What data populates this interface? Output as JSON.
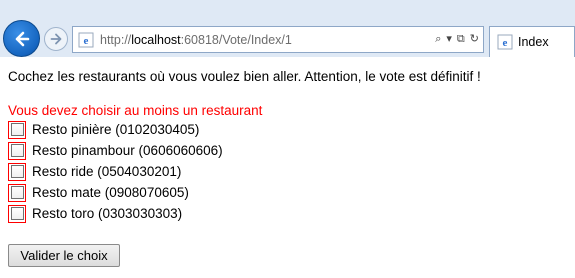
{
  "browser": {
    "url_prefix": "http://",
    "url_host": "localhost",
    "url_rest": ":60818/Vote/Index/1",
    "tab_title": "Index",
    "tools": [
      "⌕",
      "▾",
      "⧉",
      "↻"
    ]
  },
  "page": {
    "intro": "Cochez les restaurants où vous voulez bien aller. Attention, le vote est définitif !",
    "error": "Vous devez choisir au moins un restaurant",
    "restaurants": [
      {
        "label": "Resto pinière (0102030405)",
        "checked": false
      },
      {
        "label": "Resto pinambour (0606060606)",
        "checked": false
      },
      {
        "label": "Resto ride (0504030201)",
        "checked": false
      },
      {
        "label": "Resto mate (0908070605)",
        "checked": false
      },
      {
        "label": "Resto toro (0303030303)",
        "checked": false
      }
    ],
    "submit_label": "Valider le choix"
  },
  "colors": {
    "error": "#ff0000",
    "chrome_bg": "#dfe9f5",
    "back_button": "#1565c0"
  }
}
